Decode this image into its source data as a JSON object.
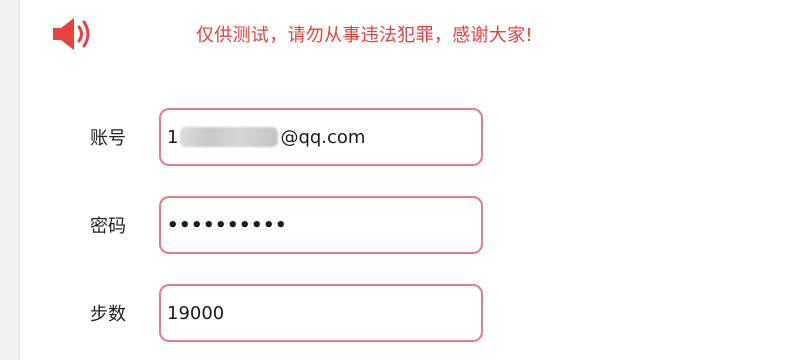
{
  "notice": {
    "icon": "speaker-icon",
    "icon_color": "#e8423f",
    "text": "仅供测试，请勿从事违法犯罪，感谢大家!"
  },
  "form": {
    "account": {
      "label": "账号",
      "value_prefix": "1",
      "value_suffix": "@qq.com"
    },
    "password": {
      "label": "密码",
      "value": "••••••••••"
    },
    "steps": {
      "label": "步数",
      "value": "19000"
    }
  },
  "colors": {
    "accent": "#e8423f",
    "field_border": "#e8798a"
  }
}
